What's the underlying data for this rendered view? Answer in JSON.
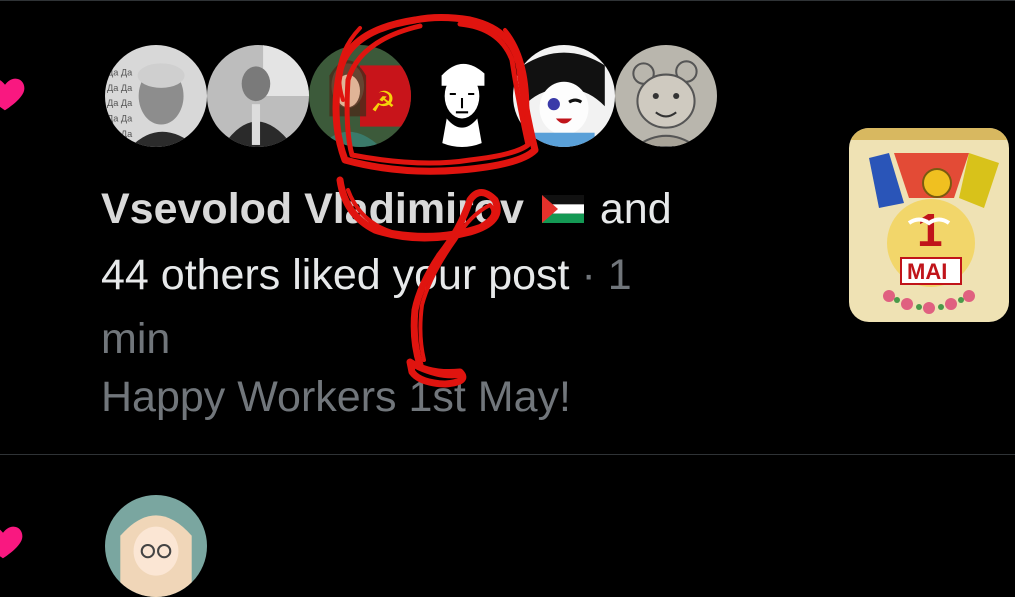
{
  "notification": {
    "liker_name": "Vsevolod Vladimirov",
    "flag_icon": "palestine-flag-icon",
    "and_text": "and",
    "others_text": "44 others liked your post",
    "separator": "·",
    "time_part1": "1",
    "time_part2": "min",
    "post_text": "Happy Workers 1st May!",
    "thumbnail_text": "MAI",
    "thumbnail_number": "1"
  },
  "colors": {
    "like_heart": "#f91880",
    "scribble": "#e0140f",
    "muted": "#71767b",
    "divider": "#2f3336"
  }
}
